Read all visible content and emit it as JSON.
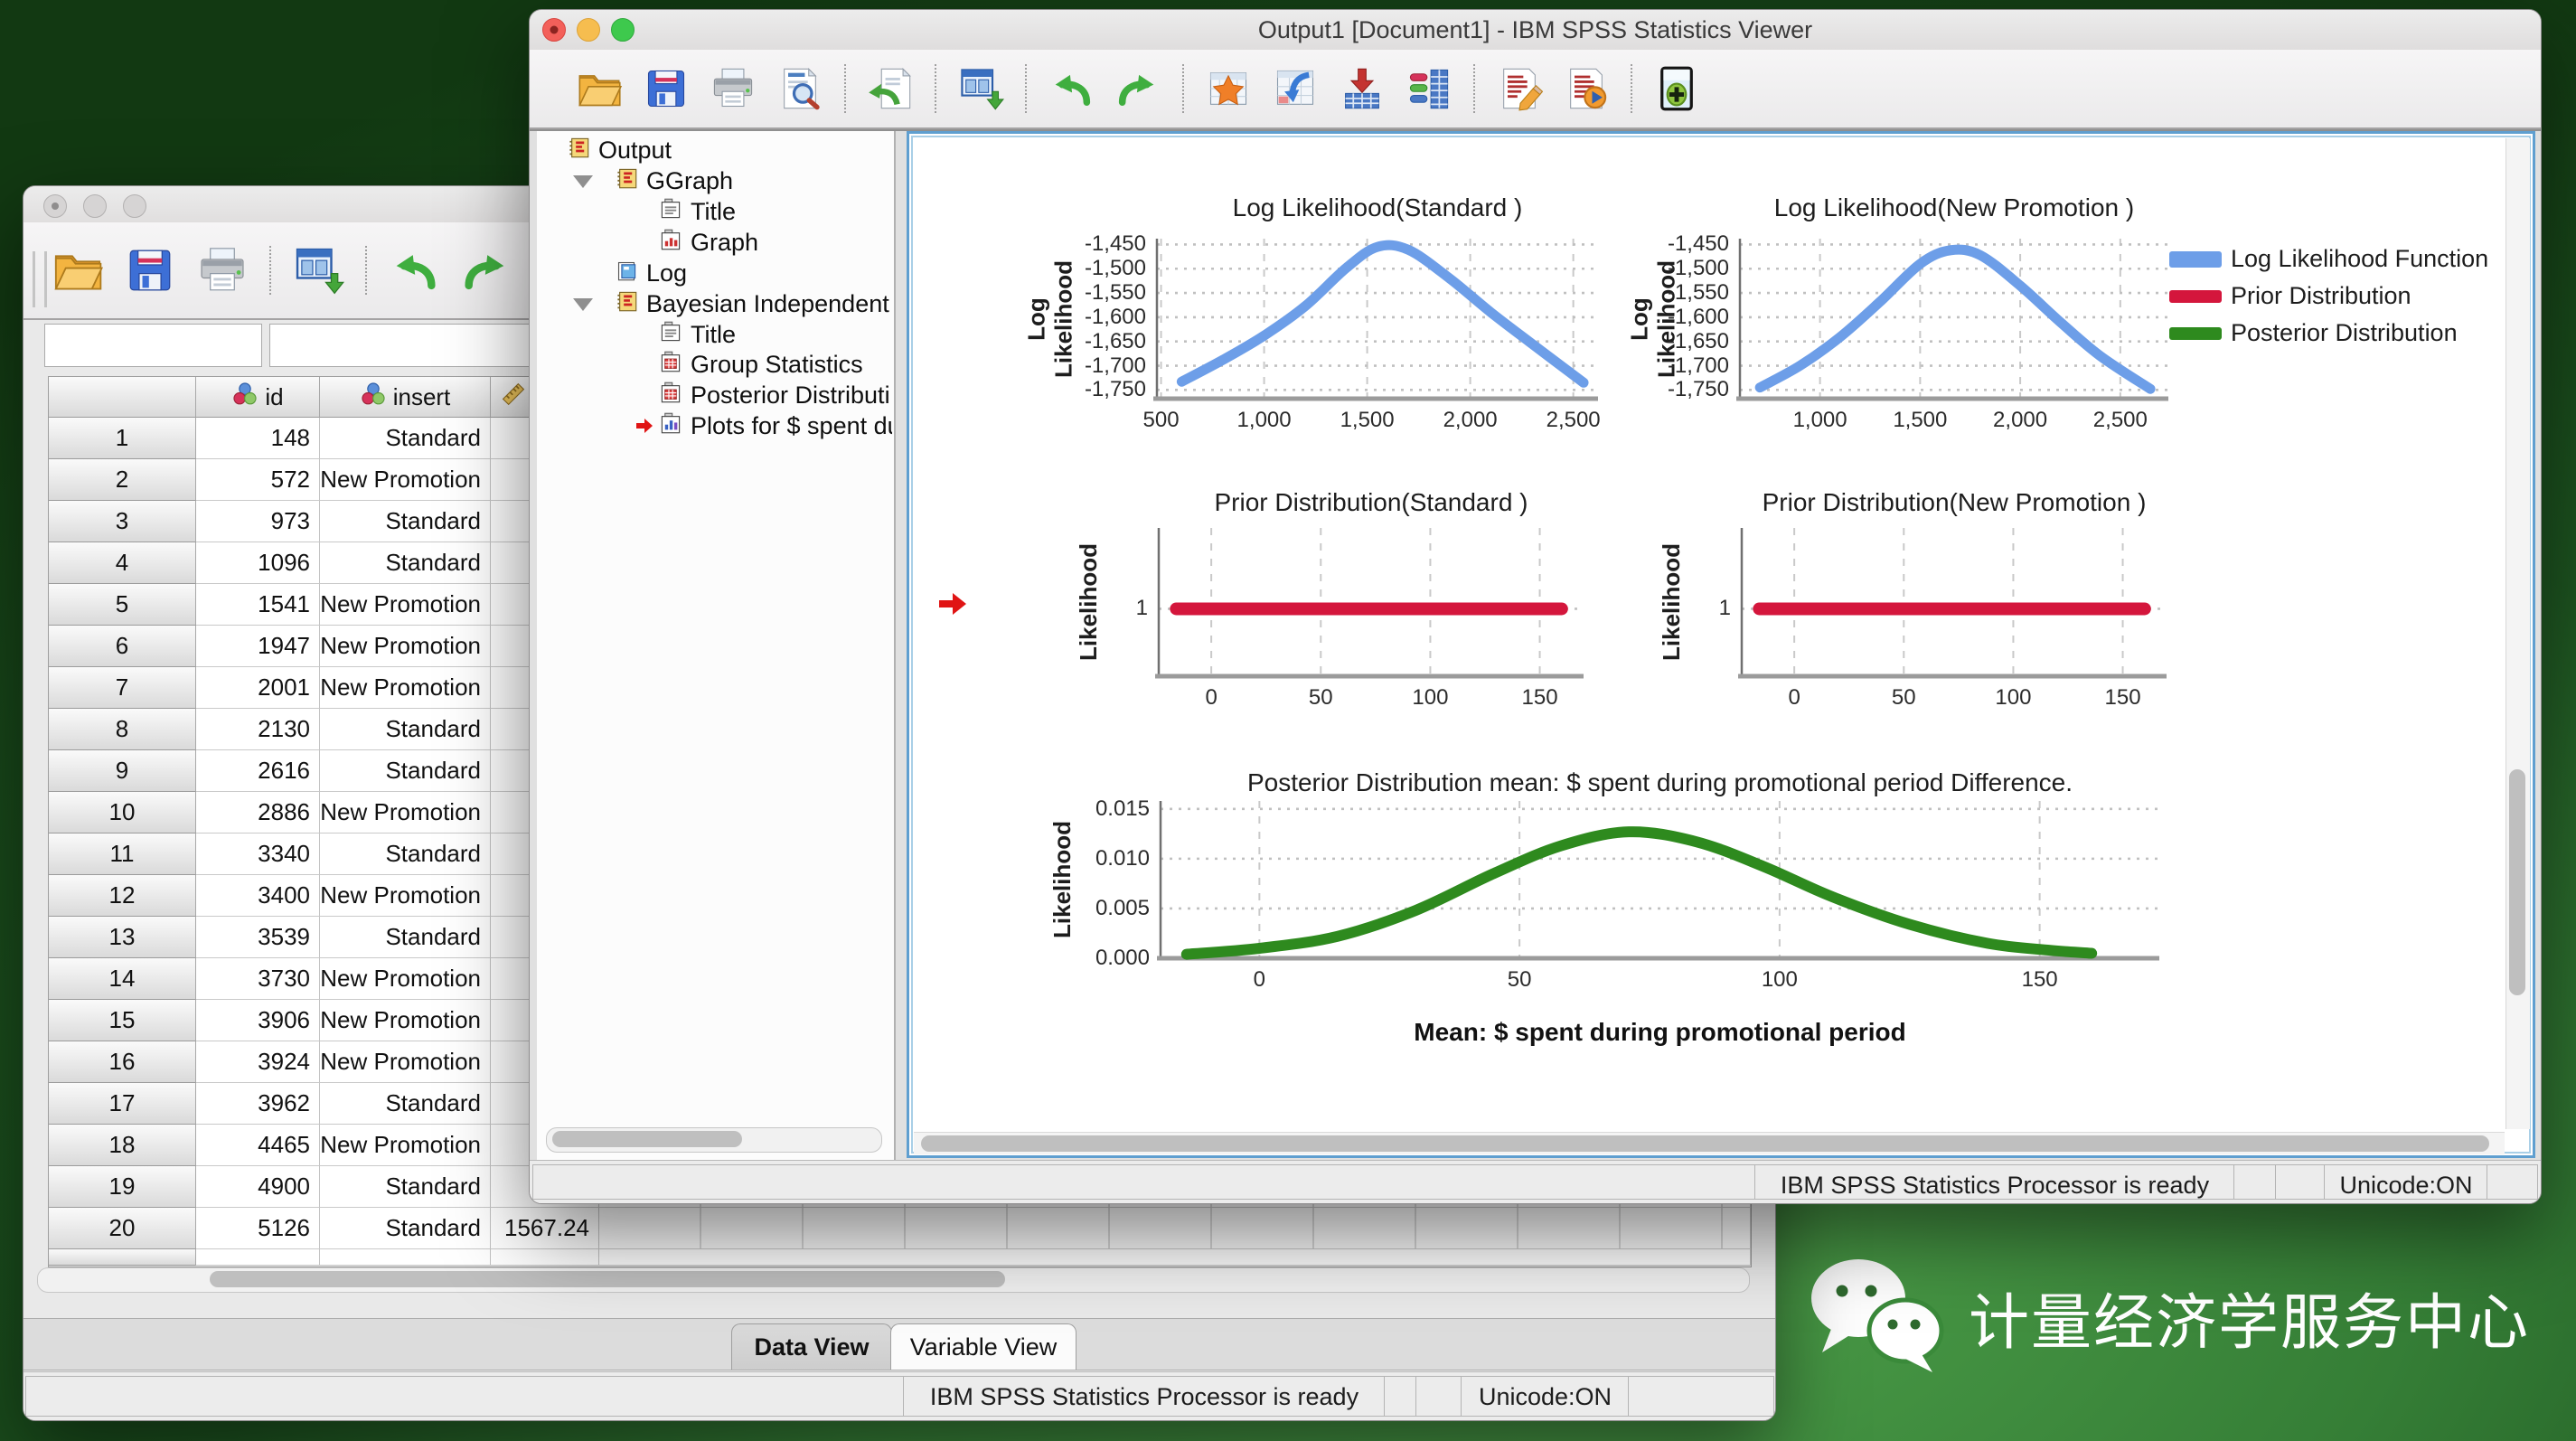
{
  "desktop": {
    "watermark_text": "计量经济学服务中心"
  },
  "viewer_window": {
    "title": "Output1 [Document1] - IBM SPSS Statistics Viewer",
    "toolbar": {
      "icons": [
        "open-folder",
        "save",
        "print",
        "print-preview",
        "|",
        "export-document",
        "|",
        "output-window",
        "|",
        "undo",
        "redo",
        "|",
        "goto-data",
        "goto-case",
        "insert-data",
        "variables",
        "|",
        "edit-document",
        "run-document",
        "|",
        "designate-window"
      ]
    },
    "tree": {
      "items": [
        {
          "label": "Output",
          "icon": "book",
          "level": 0
        },
        {
          "label": "GGraph",
          "icon": "book",
          "level": 1,
          "expanded": true
        },
        {
          "label": "Title",
          "icon": "title",
          "level": 2
        },
        {
          "label": "Graph",
          "icon": "chart-red",
          "level": 2
        },
        {
          "label": "Log",
          "icon": "book-blue",
          "level": 1
        },
        {
          "label": "Bayesian Independent",
          "icon": "book",
          "level": 1,
          "expanded": true
        },
        {
          "label": "Title",
          "icon": "title",
          "level": 2
        },
        {
          "label": "Group Statistics",
          "icon": "table",
          "level": 2
        },
        {
          "label": "Posterior Distributi",
          "icon": "table",
          "level": 2
        },
        {
          "label": "Plots for $ spent du",
          "icon": "chart-blue",
          "level": 2,
          "current": true
        }
      ]
    },
    "content": {
      "legend": [
        {
          "label": "Log Likelihood Function",
          "color": "#6D9EE8",
          "h": 18
        },
        {
          "label": "Prior Distribution",
          "color": "#D4163C",
          "h": 14
        },
        {
          "label": "Posterior Distribution",
          "color": "#2E8A1E",
          "h": 14
        }
      ]
    },
    "status_bar": {
      "processor": "IBM SPSS Statistics Processor is ready",
      "unicode": "Unicode:ON"
    }
  },
  "data_window": {
    "toolbar": {
      "icons": [
        "open-folder",
        "save",
        "print",
        "|",
        "output-window",
        "|",
        "undo",
        "redo",
        "|"
      ]
    },
    "tabs": [
      {
        "label": "Data View",
        "active": true
      },
      {
        "label": "Variable View",
        "active": false
      }
    ],
    "table": {
      "columns": [
        {
          "label": "",
          "icon": ""
        },
        {
          "label": "id",
          "icon": "nominal"
        },
        {
          "label": "insert",
          "icon": "nominal"
        },
        {
          "label": "",
          "icon": "scale"
        }
      ],
      "rows": [
        {
          "n": 1,
          "id": "148",
          "insert": "Standard",
          "extra": ""
        },
        {
          "n": 2,
          "id": "572",
          "insert": "New Promotion",
          "extra": ""
        },
        {
          "n": 3,
          "id": "973",
          "insert": "Standard",
          "extra": ""
        },
        {
          "n": 4,
          "id": "1096",
          "insert": "Standard",
          "extra": ""
        },
        {
          "n": 5,
          "id": "1541",
          "insert": "New Promotion",
          "extra": ""
        },
        {
          "n": 6,
          "id": "1947",
          "insert": "New Promotion",
          "extra": ""
        },
        {
          "n": 7,
          "id": "2001",
          "insert": "New Promotion",
          "extra": ""
        },
        {
          "n": 8,
          "id": "2130",
          "insert": "Standard",
          "extra": ""
        },
        {
          "n": 9,
          "id": "2616",
          "insert": "Standard",
          "extra": ""
        },
        {
          "n": 10,
          "id": "2886",
          "insert": "New Promotion",
          "extra": ""
        },
        {
          "n": 11,
          "id": "3340",
          "insert": "Standard",
          "extra": ""
        },
        {
          "n": 12,
          "id": "3400",
          "insert": "New Promotion",
          "extra": ""
        },
        {
          "n": 13,
          "id": "3539",
          "insert": "Standard",
          "extra": ""
        },
        {
          "n": 14,
          "id": "3730",
          "insert": "New Promotion",
          "extra": ""
        },
        {
          "n": 15,
          "id": "3906",
          "insert": "New Promotion",
          "extra": ""
        },
        {
          "n": 16,
          "id": "3924",
          "insert": "New Promotion",
          "extra": ""
        },
        {
          "n": 17,
          "id": "3962",
          "insert": "Standard",
          "extra": ""
        },
        {
          "n": 18,
          "id": "4465",
          "insert": "New Promotion",
          "extra": ""
        },
        {
          "n": 19,
          "id": "4900",
          "insert": "Standard",
          "extra": ""
        },
        {
          "n": 20,
          "id": "5126",
          "insert": "Standard",
          "extra": "1567.24"
        }
      ]
    },
    "status_bar": {
      "processor": "IBM SPSS Statistics Processor is ready",
      "unicode": "Unicode:ON"
    }
  },
  "chart_data": [
    {
      "id": "loglik_standard",
      "type": "line",
      "title": "Log Likelihood(Standard )",
      "ylabel": "Log\nLikelihood",
      "xlim": [
        480,
        2620
      ],
      "ylim": [
        -1768,
        -1438
      ],
      "grid": true,
      "legend_position": "right-of-row",
      "xticks": [
        {
          "v": 500,
          "label": "500"
        },
        {
          "v": 1000,
          "label": "1,000"
        },
        {
          "v": 1500,
          "label": "1,500"
        },
        {
          "v": 2000,
          "label": "2,000"
        },
        {
          "v": 2500,
          "label": "2,500"
        }
      ],
      "yticks": [
        {
          "v": -1450,
          "label": "-1,450"
        },
        {
          "v": -1500,
          "label": "-1,500"
        },
        {
          "v": -1550,
          "label": "-1,550"
        },
        {
          "v": -1600,
          "label": "-1,600"
        },
        {
          "v": -1650,
          "label": "-1,650"
        },
        {
          "v": -1700,
          "label": "-1,700"
        },
        {
          "v": -1750,
          "label": "-1,750"
        }
      ],
      "series": [
        {
          "name": "Log Likelihood Function",
          "color": "#6D9EE8",
          "width": 11,
          "points": [
            [
              600,
              -1733
            ],
            [
              800,
              -1688
            ],
            [
              1000,
              -1638
            ],
            [
              1200,
              -1577
            ],
            [
              1400,
              -1498
            ],
            [
              1550,
              -1455
            ],
            [
              1700,
              -1461
            ],
            [
              1900,
              -1520
            ],
            [
              2100,
              -1590
            ],
            [
              2300,
              -1655
            ],
            [
              2550,
              -1735
            ]
          ]
        }
      ]
    },
    {
      "id": "loglik_new",
      "type": "line",
      "title": "Log Likelihood(New Promotion )",
      "ylabel": "Log\nLikelihood",
      "xlim": [
        600,
        2740
      ],
      "ylim": [
        -1768,
        -1438
      ],
      "grid": true,
      "xticks": [
        {
          "v": 1000,
          "label": "1,000"
        },
        {
          "v": 1500,
          "label": "1,500"
        },
        {
          "v": 2000,
          "label": "2,000"
        },
        {
          "v": 2500,
          "label": "2,500"
        }
      ],
      "yticks": [
        {
          "v": -1450,
          "label": "-1,450"
        },
        {
          "v": -1500,
          "label": "-1,500"
        },
        {
          "v": -1550,
          "label": "-1,550"
        },
        {
          "v": -1600,
          "label": "-1,600"
        },
        {
          "v": -1650,
          "label": "-1,650"
        },
        {
          "v": -1700,
          "label": "-1,700"
        },
        {
          "v": -1750,
          "label": "-1,750"
        }
      ],
      "series": [
        {
          "name": "Log Likelihood Function",
          "color": "#6D9EE8",
          "width": 11,
          "points": [
            [
              700,
              -1745
            ],
            [
              900,
              -1700
            ],
            [
              1100,
              -1641
            ],
            [
              1300,
              -1568
            ],
            [
              1500,
              -1490
            ],
            [
              1650,
              -1462
            ],
            [
              1800,
              -1472
            ],
            [
              2000,
              -1535
            ],
            [
              2200,
              -1610
            ],
            [
              2400,
              -1680
            ],
            [
              2650,
              -1748
            ]
          ]
        }
      ]
    },
    {
      "id": "prior_standard",
      "type": "line",
      "title": "Prior Distribution(Standard )",
      "ylabel": "Likelihood",
      "xlim": [
        -24,
        170
      ],
      "ylim": [
        0,
        2.2
      ],
      "grid": true,
      "xticks": [
        {
          "v": 0,
          "label": "0"
        },
        {
          "v": 50,
          "label": "50"
        },
        {
          "v": 100,
          "label": "100"
        },
        {
          "v": 150,
          "label": "150"
        }
      ],
      "yticks": [
        {
          "v": 1,
          "label": "1"
        }
      ],
      "series": [
        {
          "name": "Prior Distribution",
          "color": "#D4163C",
          "width": 14,
          "points": [
            [
              -16,
              1
            ],
            [
              160,
              1
            ]
          ]
        }
      ]
    },
    {
      "id": "prior_new",
      "type": "line",
      "title": "Prior Distribution(New Promotion )",
      "ylabel": "Likelihood",
      "xlim": [
        -24,
        170
      ],
      "ylim": [
        0,
        2.2
      ],
      "grid": true,
      "xticks": [
        {
          "v": 0,
          "label": "0"
        },
        {
          "v": 50,
          "label": "50"
        },
        {
          "v": 100,
          "label": "100"
        },
        {
          "v": 150,
          "label": "150"
        }
      ],
      "yticks": [
        {
          "v": 1,
          "label": "1"
        }
      ],
      "series": [
        {
          "name": "Prior Distribution",
          "color": "#D4163C",
          "width": 14,
          "points": [
            [
              -16,
              1
            ],
            [
              160,
              1
            ]
          ]
        }
      ]
    },
    {
      "id": "posterior_diff",
      "type": "line",
      "title": "Posterior Distribution mean: $ spent during promotional period Difference.",
      "ylabel": "Likelihood",
      "xlabel": "Mean: $ spent during promotional period",
      "xlim": [
        -19,
        173
      ],
      "ylim": [
        0,
        0.0158
      ],
      "grid": true,
      "xticks": [
        {
          "v": 0,
          "label": "0"
        },
        {
          "v": 50,
          "label": "50"
        },
        {
          "v": 100,
          "label": "100"
        },
        {
          "v": 150,
          "label": "150"
        }
      ],
      "yticks": [
        {
          "v": 0,
          "label": "0.000"
        },
        {
          "v": 0.005,
          "label": "0.005"
        },
        {
          "v": 0.01,
          "label": "0.010"
        },
        {
          "v": 0.015,
          "label": "0.015"
        }
      ],
      "series": [
        {
          "name": "Posterior Distribution",
          "color": "#2E8A1E",
          "width": 12,
          "points": [
            [
              -14,
              0.0004
            ],
            [
              0,
              0.001
            ],
            [
              15,
              0.0022
            ],
            [
              30,
              0.0048
            ],
            [
              45,
              0.0085
            ],
            [
              58,
              0.0113
            ],
            [
              71,
              0.0127
            ],
            [
              84,
              0.0117
            ],
            [
              97,
              0.0092
            ],
            [
              110,
              0.0062
            ],
            [
              125,
              0.0034
            ],
            [
              140,
              0.0015
            ],
            [
              152,
              0.0008
            ],
            [
              160,
              0.0005
            ]
          ]
        }
      ]
    }
  ]
}
